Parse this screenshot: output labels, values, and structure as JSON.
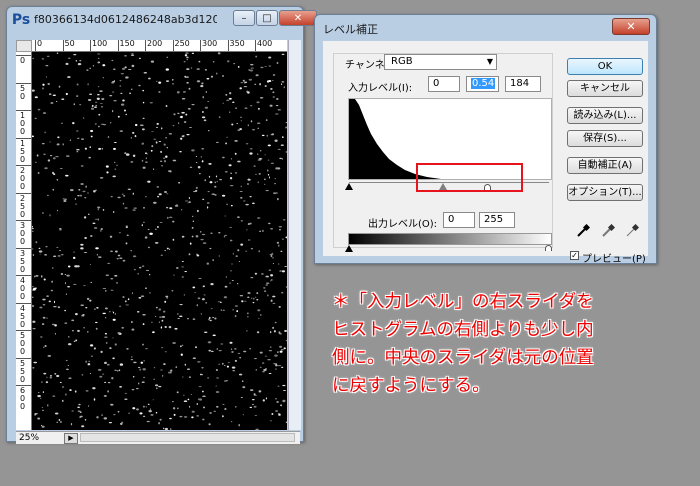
{
  "document_window": {
    "title": "f80366134d0612486248ab3d12028...",
    "minimize_glyph": "–",
    "maximize_glyph": "□",
    "close_glyph": "✕",
    "ruler_h_labels": [
      "0",
      "50",
      "100",
      "150",
      "200",
      "250",
      "300",
      "350",
      "400"
    ],
    "ruler_v_labels": [
      "0",
      "50",
      "100",
      "150",
      "200",
      "250",
      "300",
      "350",
      "400",
      "450",
      "500",
      "550",
      "600"
    ],
    "zoom": "25%"
  },
  "levels_dialog": {
    "title": "レベル補正",
    "close_glyph": "✕",
    "channel_label": "チャンネル(C):",
    "channel_value": "RGB",
    "input_levels_label": "入力レベル(I):",
    "input_black": "0",
    "input_gamma": "0.54",
    "input_white": "184",
    "output_levels_label": "出力レベル(O):",
    "output_black": "0",
    "output_white": "255",
    "buttons": {
      "ok": "OK",
      "cancel": "キャンセル",
      "load": "読み込み(L)...",
      "save": "保存(S)...",
      "auto": "自動補正(A)",
      "options": "オプション(T)..."
    },
    "preview_label": "プレビュー(P)",
    "preview_checked": true,
    "eyedroppers": [
      "black-eyedropper-icon",
      "gray-eyedropper-icon",
      "white-eyedropper-icon"
    ],
    "highlight_color": "#e8141d"
  },
  "annotation": {
    "lines": [
      "＊「入力レベル」の右スライダを",
      "ヒストグラムの右側よりも少し内",
      "側に。中央のスライダは元の位置",
      "に戻すようにする。"
    ],
    "color": "#ef0000"
  }
}
